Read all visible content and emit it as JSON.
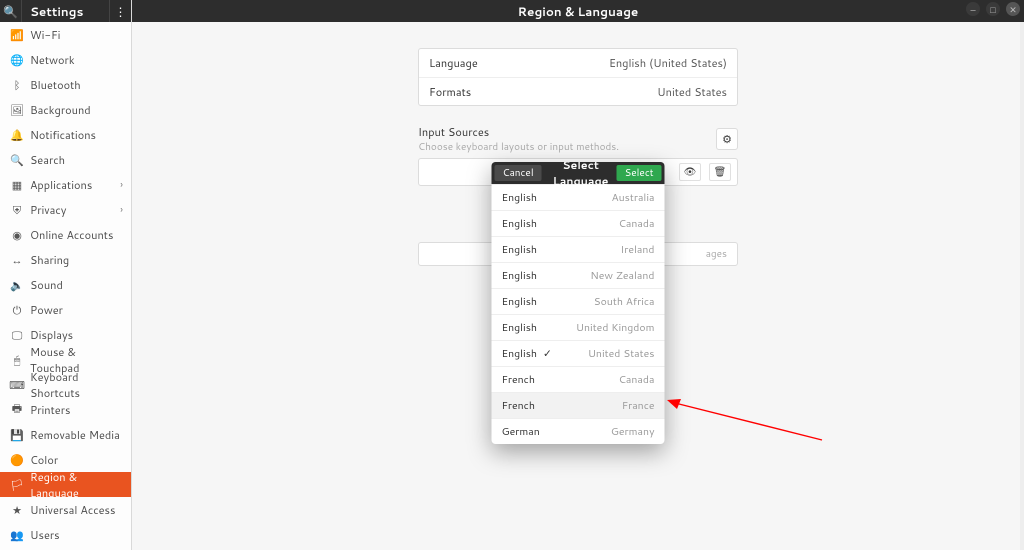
{
  "sidebar": {
    "title": "Settings",
    "items": [
      {
        "icon": "📶",
        "label": "Wi-Fi"
      },
      {
        "icon": "🌐",
        "label": "Network"
      },
      {
        "icon": "ᛒ",
        "label": "Bluetooth"
      },
      {
        "icon": "🖼",
        "label": "Background"
      },
      {
        "icon": "🔔",
        "label": "Notifications"
      },
      {
        "icon": "🔍",
        "label": "Search"
      },
      {
        "icon": "▦",
        "label": "Applications",
        "chevron": true
      },
      {
        "icon": "⛨",
        "label": "Privacy",
        "chevron": true
      },
      {
        "icon": "◉",
        "label": "Online Accounts"
      },
      {
        "icon": "↔",
        "label": "Sharing"
      },
      {
        "icon": "🔈",
        "label": "Sound"
      },
      {
        "icon": "⏻",
        "label": "Power"
      },
      {
        "icon": "🖵",
        "label": "Displays"
      },
      {
        "icon": "🖱",
        "label": "Mouse & Touchpad"
      },
      {
        "icon": "⌨",
        "label": "Keyboard Shortcuts"
      },
      {
        "icon": "🖶",
        "label": "Printers"
      },
      {
        "icon": "💾",
        "label": "Removable Media"
      },
      {
        "icon": "🟠",
        "label": "Color"
      },
      {
        "icon": "🏳",
        "label": "Region & Language",
        "active": true
      },
      {
        "icon": "★",
        "label": "Universal Access"
      },
      {
        "icon": "👥",
        "label": "Users"
      }
    ]
  },
  "main": {
    "title": "Region & Language",
    "rows": {
      "language_key": "Language",
      "language_val": "English (United States)",
      "formats_key": "Formats",
      "formats_val": "United States"
    },
    "input_sources": {
      "title": "Input Sources",
      "subtitle": "Choose keyboard layouts or input methods."
    },
    "wide_bar_hint": "ages"
  },
  "dialog": {
    "cancel": "Cancel",
    "title": "Select Language",
    "select": "Select",
    "items": [
      {
        "lang": "English",
        "region": "Australia"
      },
      {
        "lang": "English",
        "region": "Canada"
      },
      {
        "lang": "English",
        "region": "Ireland"
      },
      {
        "lang": "English",
        "region": "New Zealand"
      },
      {
        "lang": "English",
        "region": "South Africa"
      },
      {
        "lang": "English",
        "region": "United Kingdom"
      },
      {
        "lang": "English",
        "region": "United States",
        "checked": true
      },
      {
        "lang": "French",
        "region": "Canada"
      },
      {
        "lang": "French",
        "region": "France",
        "hover": true
      },
      {
        "lang": "German",
        "region": "Germany"
      }
    ]
  }
}
